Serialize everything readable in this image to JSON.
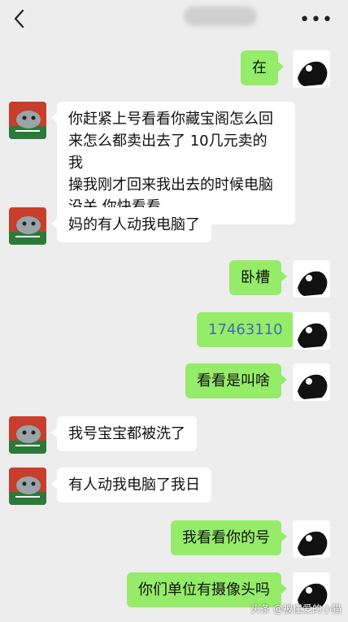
{
  "header": {
    "back_icon": "chevron-left-icon",
    "more_label": "•••"
  },
  "messages": [
    {
      "side": "right",
      "text": "在"
    },
    {
      "side": "left",
      "lines": [
        "你赶紧上号看看你藏宝阁怎么回",
        "来怎么都卖出去了 10几元卖的 我",
        "操我刚才回来我出去的时候电脑",
        "没关 你快看看"
      ]
    },
    {
      "side": "left",
      "text": "妈的有人动我电脑了"
    },
    {
      "side": "right",
      "text": "卧槽"
    },
    {
      "side": "right",
      "text": "17463110"
    },
    {
      "side": "right",
      "text": "看看是叫啥"
    },
    {
      "side": "left",
      "text": "我号宝宝都被洗了"
    },
    {
      "side": "left",
      "text": "有人动我电脑了我日"
    },
    {
      "side": "right",
      "text": "我看看你的号"
    },
    {
      "side": "right",
      "text": "你们单位有摄像头吗"
    }
  ],
  "watermark": "头条 @被懂爱的小猫",
  "colors": {
    "background": "#ededed",
    "bubble_sent": "#95ec69",
    "bubble_received": "#ffffff",
    "link_number": "#3a6fb0"
  }
}
